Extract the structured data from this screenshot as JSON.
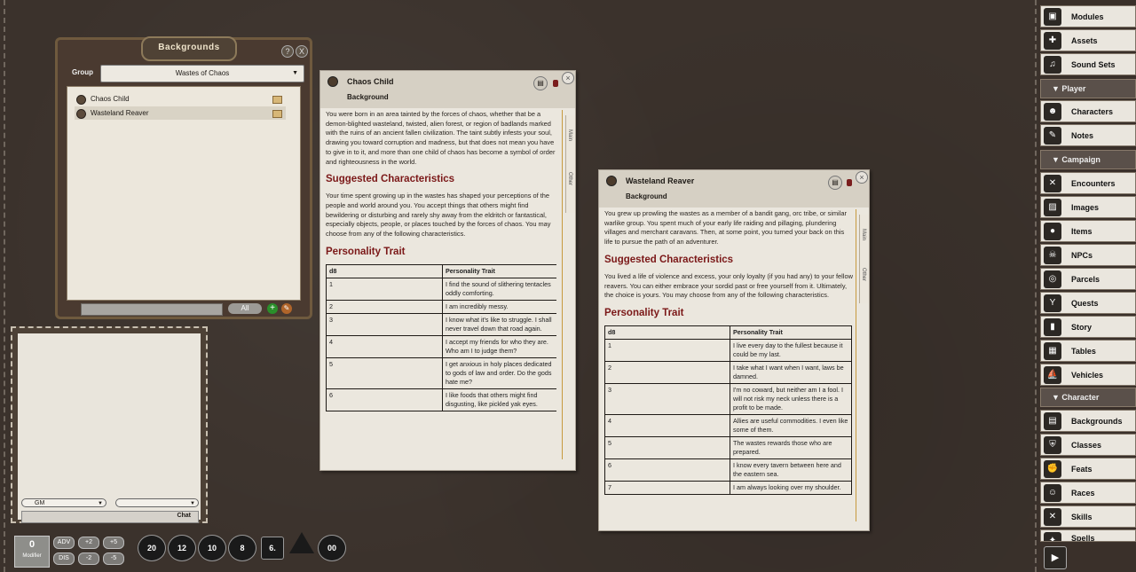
{
  "backgrounds_window": {
    "title": "Backgrounds",
    "help": "?",
    "close": "X",
    "group_label": "Group",
    "group_value": "Wastes of Chaos",
    "items": [
      {
        "label": "Chaos Child"
      },
      {
        "label": "Wasteland Reaver"
      }
    ],
    "filter_all": "All",
    "add": "+",
    "edit": "✎"
  },
  "chat": {
    "identity": "GM",
    "target": "",
    "label": "Chat"
  },
  "dice_bar": {
    "modifier_value": "0",
    "modifier_label": "Modifier",
    "buttons": [
      "ADV",
      "+2",
      "+5",
      "DIS",
      "-2",
      "-5"
    ],
    "dice": [
      "20",
      "12",
      "10",
      "8",
      "6.",
      "4",
      "00"
    ]
  },
  "sheets": [
    {
      "name": "Chaos Child",
      "type": "Background",
      "intro": "You were born in an area tainted by the forces of chaos, whether that be a demon-blighted wasteland, twisted, alien forest, or region of badlands marked with the ruins of an ancient fallen civilization. The taint subtly infests your soul, drawing you toward corruption and madness, but that does not mean you have to give in to it, and more than one child of chaos has become a symbol of order and righteousness in the world.",
      "heading1": "Suggested Characteristics",
      "characteristics": "Your time spent growing up in the wastes has shaped your perceptions of the people and world around you. You accept things that others might find bewildering or disturbing and rarely shy away from the eldritch or fantastical, especially objects, people, or places touched by the forces of chaos. You may choose from any of the following characteristics.",
      "heading2": "Personality Trait",
      "table_headers": [
        "d8",
        "Personality Trait"
      ],
      "rows": [
        [
          "1",
          "I find the sound of slithering tentacles oddly comforting."
        ],
        [
          "2",
          "I am incredibly messy."
        ],
        [
          "3",
          "I know what it's like to struggle. I shall never travel down that road again."
        ],
        [
          "4",
          "I accept my friends for who they are. Who am I to judge them?"
        ],
        [
          "5",
          "I get anxious in holy places dedicated to gods of law and order. Do the gods hate me?"
        ],
        [
          "6",
          "I like foods that others might find disgusting, like pickled yak eyes."
        ]
      ],
      "tab_main": "Main",
      "tab_other": "Other"
    },
    {
      "name": "Wasteland Reaver",
      "type": "Background",
      "intro": "You grew up prowling the wastes as a member of a bandit gang, orc tribe, or similar warlike group. You spent much of your early life raiding and pillaging, plundering villages and merchant caravans. Then, at some point, you turned your back on this life to pursue the path of an adventurer.",
      "heading1": "Suggested Characteristics",
      "characteristics": "You lived a life of violence and excess, your only loyalty (if you had any) to your fellow reavers. You can either embrace your sordid past or free yourself from it. Ultimately, the choice is yours. You may choose from any of the following characteristics.",
      "heading2": "Personality Trait",
      "table_headers": [
        "d8",
        "Personality Trait"
      ],
      "rows": [
        [
          "1",
          "I live every day to the fullest because it could be my last."
        ],
        [
          "2",
          "I take what I want when I want, laws be damned."
        ],
        [
          "3",
          "I'm no coward, but neither am I a fool. I will not risk my neck unless there is a profit to be made."
        ],
        [
          "4",
          "Allies are useful commodities. I even like some of them."
        ],
        [
          "5",
          "The wastes rewards those who are prepared."
        ],
        [
          "6",
          "I know every tavern between here and the eastern sea."
        ],
        [
          "7",
          "I am always looking over my shoulder."
        ]
      ],
      "tab_main": "Main",
      "tab_other": "Other"
    }
  ],
  "sidebar": {
    "top_items": [
      {
        "label": "Modules",
        "icon": "modules-icon"
      },
      {
        "label": "Assets",
        "icon": "puzzle-icon"
      },
      {
        "label": "Sound Sets",
        "icon": "music-icon"
      }
    ],
    "categories": [
      {
        "label": "▼ Player",
        "items": [
          {
            "label": "Characters",
            "icon": "people-icon"
          },
          {
            "label": "Notes",
            "icon": "notes-icon"
          }
        ]
      },
      {
        "label": "▼ Campaign",
        "items": [
          {
            "label": "Encounters",
            "icon": "swords-icon"
          },
          {
            "label": "Images",
            "icon": "images-icon"
          },
          {
            "label": "Items",
            "icon": "bag-icon"
          },
          {
            "label": "NPCs",
            "icon": "skull-icon"
          },
          {
            "label": "Parcels",
            "icon": "coins-icon"
          },
          {
            "label": "Quests",
            "icon": "goblet-icon"
          },
          {
            "label": "Story",
            "icon": "book-icon"
          },
          {
            "label": "Tables",
            "icon": "table-icon"
          },
          {
            "label": "Vehicles",
            "icon": "ship-icon"
          }
        ]
      },
      {
        "label": "▼ Character",
        "items": [
          {
            "label": "Backgrounds",
            "icon": "backgrounds-icon"
          },
          {
            "label": "Classes",
            "icon": "shield-icon"
          },
          {
            "label": "Feats",
            "icon": "fist-icon"
          },
          {
            "label": "Races",
            "icon": "race-icon"
          },
          {
            "label": "Skills",
            "icon": "skills-icon"
          },
          {
            "label": "Spells",
            "icon": "spells-icon"
          }
        ]
      }
    ]
  }
}
